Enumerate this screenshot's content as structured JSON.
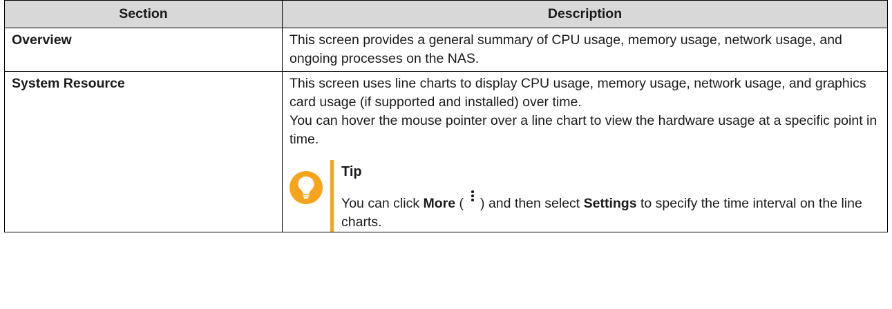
{
  "table": {
    "headers": {
      "section": "Section",
      "description": "Description"
    },
    "rows": [
      {
        "section": "Overview",
        "paragraphs": [
          "This screen provides a general summary of CPU usage, memory usage, network usage, and ongoing processes on the NAS."
        ]
      },
      {
        "section": "System Resource",
        "paragraphs": [
          "This screen uses line charts to display CPU usage, memory usage, network usage, and graphics card usage (if supported and installed) over time.",
          "You can hover the mouse pointer over a line chart to view the hardware usage at a specific point in time."
        ],
        "tip": {
          "title": "Tip",
          "segments": [
            {
              "text": "You can click ",
              "bold": false
            },
            {
              "text": "More",
              "bold": true
            },
            {
              "text": " (",
              "bold": false
            },
            {
              "icon": "more-vertical-icon"
            },
            {
              "text": ") and then select ",
              "bold": false
            },
            {
              "text": "Settings",
              "bold": true
            },
            {
              "text": " to specify the time interval on the line charts.",
              "bold": false
            }
          ]
        }
      }
    ]
  },
  "colors": {
    "header_bg": "#d8d8d8",
    "tip_accent": "#f5a41c",
    "border": "#000000"
  },
  "icons": {
    "tip": "lightbulb-icon",
    "more": "more-vertical-icon"
  }
}
